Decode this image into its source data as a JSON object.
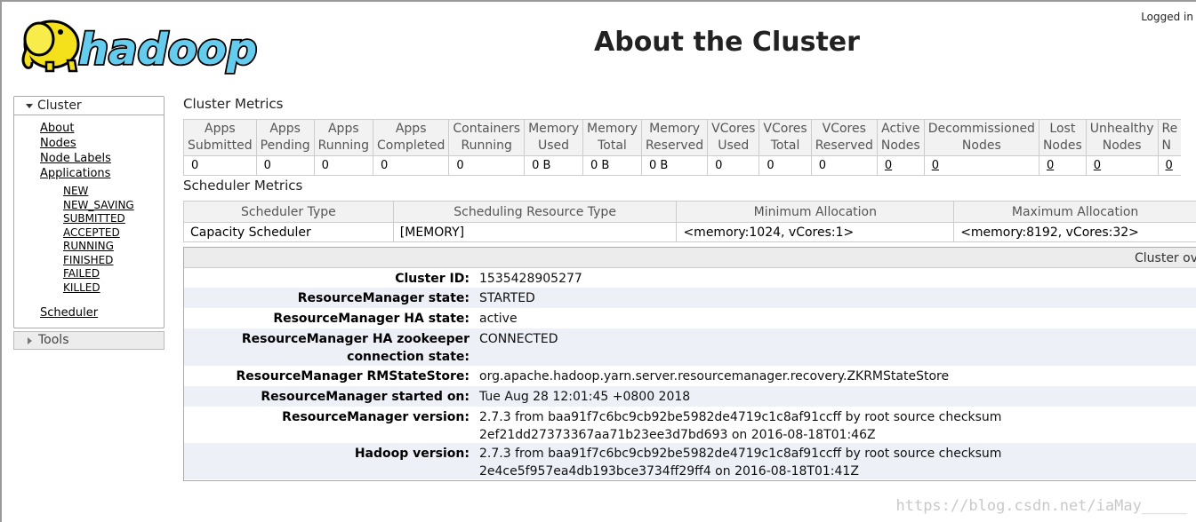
{
  "header": {
    "logo_text": "hadoop",
    "page_title": "About the Cluster",
    "logged_in": "Logged in"
  },
  "sidebar": {
    "cluster_label": "Cluster",
    "links": [
      "About",
      "Nodes",
      "Node Labels",
      "Applications"
    ],
    "app_states": [
      "NEW",
      "NEW_SAVING",
      "SUBMITTED",
      "ACCEPTED",
      "RUNNING",
      "FINISHED",
      "FAILED",
      "KILLED"
    ],
    "scheduler": "Scheduler",
    "tools_label": "Tools"
  },
  "cluster_metrics": {
    "title": "Cluster Metrics",
    "headers": [
      [
        "Apps",
        "Submitted"
      ],
      [
        "Apps",
        "Pending"
      ],
      [
        "Apps",
        "Running"
      ],
      [
        "Apps",
        "Completed"
      ],
      [
        "Containers",
        "Running"
      ],
      [
        "Memory",
        "Used"
      ],
      [
        "Memory",
        "Total"
      ],
      [
        "Memory",
        "Reserved"
      ],
      [
        "VCores",
        "Used"
      ],
      [
        "VCores",
        "Total"
      ],
      [
        "VCores",
        "Reserved"
      ],
      [
        "Active",
        "Nodes"
      ],
      [
        "Decommissioned",
        "Nodes"
      ],
      [
        "Lost",
        "Nodes"
      ],
      [
        "Unhealthy",
        "Nodes"
      ],
      [
        "Re",
        "N"
      ]
    ],
    "values": [
      "0",
      "0",
      "0",
      "0",
      "0",
      "0 B",
      "0 B",
      "0 B",
      "0",
      "0",
      "0",
      "0",
      "0",
      "0",
      "0",
      "0"
    ]
  },
  "scheduler_metrics": {
    "title": "Scheduler Metrics",
    "headers": [
      "Scheduler Type",
      "Scheduling Resource Type",
      "Minimum Allocation",
      "Maximum Allocation"
    ],
    "row": [
      "Capacity Scheduler",
      "[MEMORY]",
      "<memory:1024, vCores:1>",
      "<memory:8192, vCores:32>"
    ]
  },
  "overview": {
    "header": "Cluster ov",
    "rows": [
      {
        "k": "Cluster ID:",
        "v": "1535428905277"
      },
      {
        "k": "ResourceManager state:",
        "v": "STARTED"
      },
      {
        "k": "ResourceManager HA state:",
        "v": "active"
      },
      {
        "k": "ResourceManager HA zookeeper connection state:",
        "v": "CONNECTED"
      },
      {
        "k": "ResourceManager RMStateStore:",
        "v": "org.apache.hadoop.yarn.server.resourcemanager.recovery.ZKRMStateStore"
      },
      {
        "k": "ResourceManager started on:",
        "v": "Tue Aug 28 12:01:45 +0800 2018"
      },
      {
        "k": "ResourceManager version:",
        "v": "2.7.3 from baa91f7c6bc9cb92be5982de4719c1c8af91ccff by root source checksum 2ef21dd27373367aa71b23ee3d7bd693 on 2016-08-18T01:46Z"
      },
      {
        "k": "Hadoop version:",
        "v": "2.7.3 from baa91f7c6bc9cb92be5982de4719c1c8af91ccff by root source checksum 2e4ce5f957ea4db193bce3734ff29ff4 on 2016-08-18T01:41Z"
      }
    ]
  },
  "watermark": "https://blog.csdn.net/iaMay_____",
  "colors": {
    "logo_yellow": "#f5e11b",
    "logo_blue": "#66ccee",
    "row_alt": "#eef0f8"
  }
}
